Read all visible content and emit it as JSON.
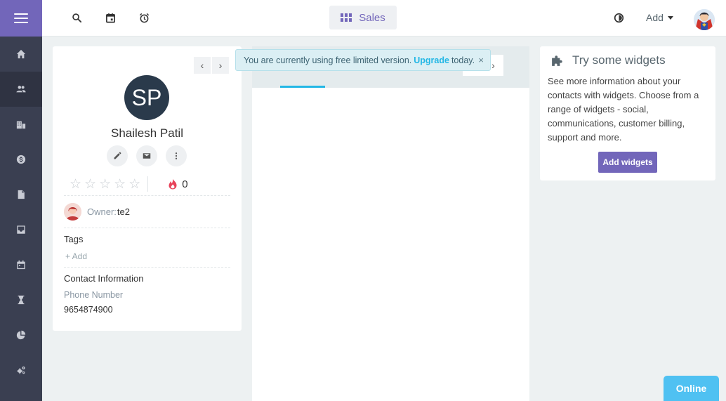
{
  "sidebar": {
    "items": [
      {
        "name": "home-icon"
      },
      {
        "name": "contacts-icon",
        "active": true
      },
      {
        "name": "companies-icon"
      },
      {
        "name": "deals-icon"
      },
      {
        "name": "documents-icon"
      },
      {
        "name": "inbox-icon"
      },
      {
        "name": "calendar-icon"
      },
      {
        "name": "activities-icon"
      },
      {
        "name": "reports-icon"
      },
      {
        "name": "admin-settings-icon"
      }
    ]
  },
  "header": {
    "module_label": "Sales",
    "add_label": "Add"
  },
  "banner": {
    "text_before": "You are currently using free limited version.",
    "link_text": "Upgrade",
    "text_after": "today.",
    "close_symbol": "×"
  },
  "contact": {
    "initials": "SP",
    "name": "Shailesh Patil",
    "star_count": 5,
    "star_symbol": "☆",
    "score": "0",
    "owner_label": "Owner:",
    "owner_value": "te2",
    "tags_title": "Tags",
    "tags_add": "+ Add",
    "info_title": "Contact Information",
    "phone_label": "Phone Number",
    "phone_value": "9654874900"
  },
  "widgets": {
    "title": "Try some widgets",
    "description": "See more information about your contacts with widgets. Choose from a range of widgets - social, communications, customer billing, support and more.",
    "button_label": "Add widgets"
  },
  "chat": {
    "label": "Online"
  },
  "colors": {
    "accent": "#7266ba",
    "sidebar": "#3a3f51",
    "info": "#23b7e5",
    "online": "#4fc1f2"
  }
}
